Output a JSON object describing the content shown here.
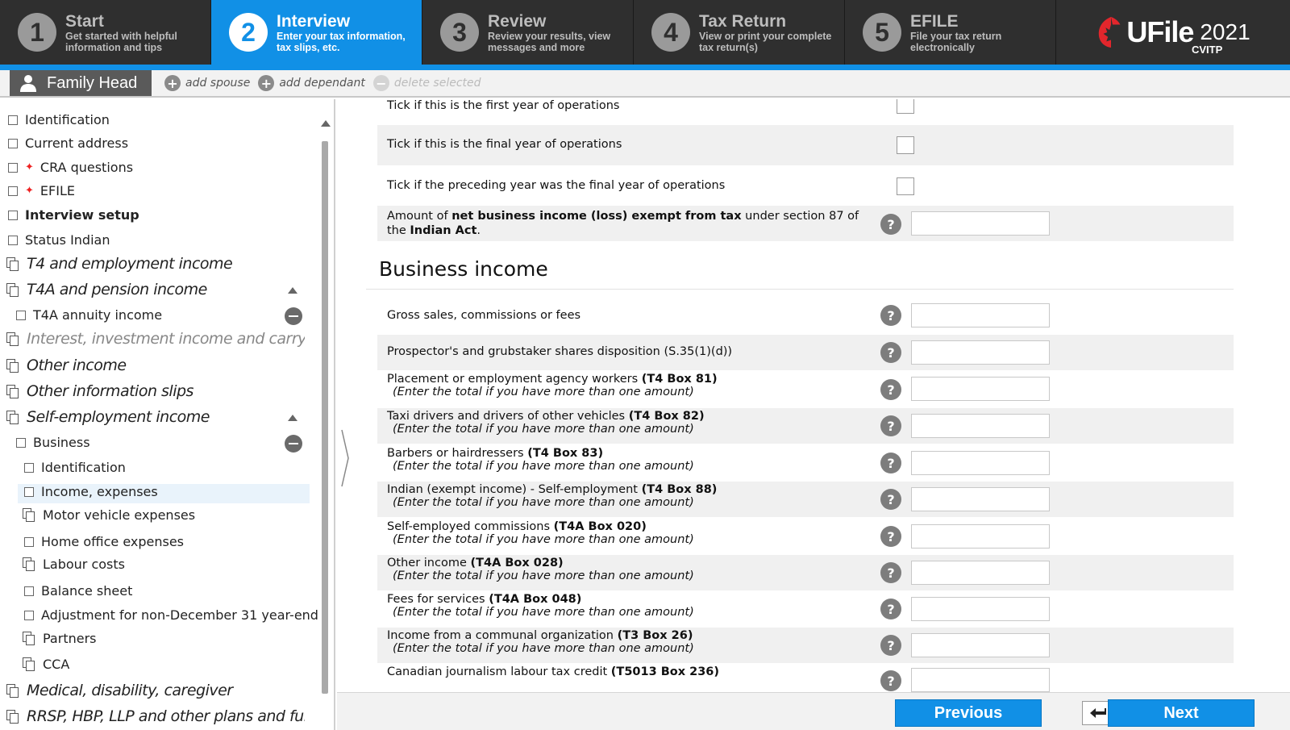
{
  "steps": [
    {
      "num": "1",
      "title": "Start",
      "sub": "Get started with helpful information and tips",
      "active": false
    },
    {
      "num": "2",
      "title": "Interview",
      "sub": "Enter your tax information, tax slips, etc.",
      "active": true
    },
    {
      "num": "3",
      "title": "Review",
      "sub": "Review your results, view messages and more",
      "active": false
    },
    {
      "num": "4",
      "title": "Tax Return",
      "sub": "View or print your complete tax return(s)",
      "active": false
    },
    {
      "num": "5",
      "title": "EFILE",
      "sub": "File your tax return electronically",
      "active": false
    }
  ],
  "brand": {
    "name": "UFile",
    "year": "2021",
    "sub": "CVITP",
    "leaf_color": "#e3262c"
  },
  "family": {
    "tab": "Family Head",
    "add_spouse": "add spouse",
    "add_dependant": "add dependant",
    "delete_selected": "delete selected"
  },
  "sidebar": {
    "identification": "Identification",
    "current_address": "Current address",
    "cra_questions": "CRA questions",
    "efile": "EFILE",
    "interview_setup": "Interview setup",
    "status_indian": "Status Indian",
    "t4": "T4 and employment income",
    "t4a": "T4A and pension income",
    "t4a_annuity": "T4A annuity income",
    "interest": "Interest, investment income and carrying charges",
    "other_income": "Other income",
    "other_slips": "Other information slips",
    "self_employment": "Self-employment income",
    "business": "Business",
    "biz_identification": "Identification",
    "income_expenses": "Income, expenses",
    "motor_vehicle": "Motor vehicle expenses",
    "home_office": "Home office expenses",
    "labour_costs": "Labour costs",
    "balance_sheet": "Balance sheet",
    "adjustment": "Adjustment for non-December 31 year-end",
    "partners": "Partners",
    "cca": "CCA",
    "medical": "Medical, disability, caregiver",
    "rrsp": "RRSP, HBP, LLP and other plans and funds"
  },
  "main": {
    "first_year": "Tick if this is the first year of operations",
    "final_year": "Tick if this is the final year of operations",
    "preceding_final": "Tick if the preceding year was the final year of operations",
    "exempt_pre": "Amount of ",
    "exempt_bold": "net business income (loss) exempt from tax",
    "exempt_mid": " under section 87 of the ",
    "exempt_bold2": "Indian Act",
    "exempt_end": ".",
    "section_title": "Business income",
    "note": "(Enter the total if you have more than one amount)",
    "rows": [
      {
        "label": "Gross sales, commissions or fees",
        "box": ""
      },
      {
        "label": "Prospector's and grubstaker shares disposition (S.35(1)(d))",
        "box": ""
      },
      {
        "label": "Placement or employment agency workers ",
        "box": "(T4 Box 81)"
      },
      {
        "label": "Taxi drivers and drivers of other vehicles ",
        "box": "(T4 Box 82)"
      },
      {
        "label": "Barbers or hairdressers ",
        "box": "(T4 Box 83)"
      },
      {
        "label": "Indian (exempt income) - Self-employment ",
        "box": "(T4 Box 88)"
      },
      {
        "label": "Self-employed commissions ",
        "box": "(T4A Box 020)"
      },
      {
        "label": "Other income ",
        "box": "(T4A Box 028)"
      },
      {
        "label": "Fees for services ",
        "box": "(T4A Box 048)"
      },
      {
        "label": "Income from a communal organization ",
        "box": "(T3 Box 26)"
      },
      {
        "label": "Canadian journalism labour tax credit ",
        "box": "(T5013 Box 236)"
      }
    ]
  },
  "buttons": {
    "previous": "Previous",
    "next": "Next"
  }
}
